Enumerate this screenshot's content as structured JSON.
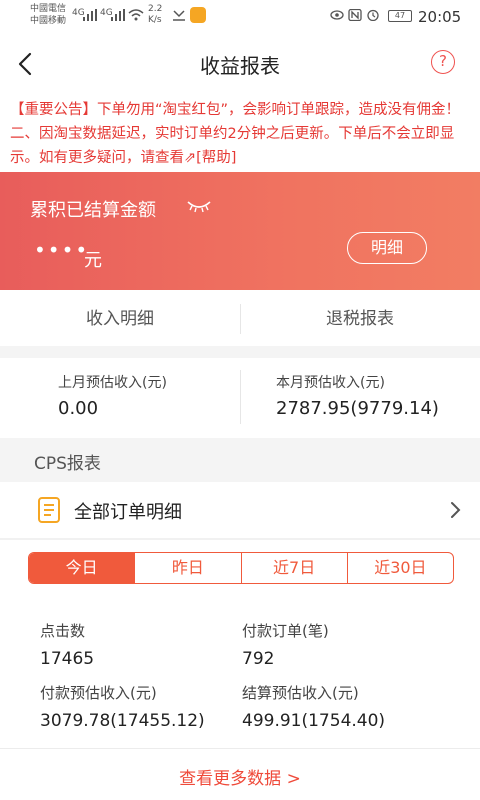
{
  "status_bar": {
    "carrier1": "中國電信",
    "carrier2": "中國移動",
    "signal1": "4G",
    "signal2": "4G",
    "speed_value": "2.2",
    "speed_unit": "K/s",
    "battery": "47",
    "time": "20:05"
  },
  "header": {
    "title": "收益报表",
    "help_label": "?"
  },
  "notice": {
    "text": "【重要公告】下单勿用“淘宝红包”，会影响订单跟踪，造成没有佣金！二、因淘宝数据延迟，实时订单约2分钟之后更新。下单后不会立即显示。如有更多疑问，请查看",
    "link": "⇗[帮助]"
  },
  "banner": {
    "label": "累积已结算金额",
    "masked_amount": "••••",
    "unit": "元",
    "detail_button": "明细",
    "color_start": "#e85d5b",
    "color_end": "#f27d63"
  },
  "tabs": [
    {
      "label": "收入明细"
    },
    {
      "label": "退税报表"
    }
  ],
  "monthly": {
    "last_month_label": "上月预估收入(元)",
    "last_month_value": "0.00",
    "this_month_label": "本月预估收入(元)",
    "this_month_value": "2787.95(9779.14)"
  },
  "cps": {
    "section_label": "CPS报表",
    "all_orders_label": "全部订单明细"
  },
  "periods": [
    {
      "label": "今日",
      "active": true
    },
    {
      "label": "昨日",
      "active": false
    },
    {
      "label": "近7日",
      "active": false
    },
    {
      "label": "近30日",
      "active": false
    }
  ],
  "stats": {
    "clicks_label": "点击数",
    "clicks_value": "17465",
    "paid_orders_label": "付款订单(笔)",
    "paid_orders_value": "792",
    "paid_income_label": "付款预估收入(元)",
    "paid_income_value": "3079.78(17455.12)",
    "settled_income_label": "结算预估收入(元)",
    "settled_income_value": "499.91(1754.40)"
  },
  "more_link": "查看更多数据 >",
  "accent_color": "#f05a3c"
}
